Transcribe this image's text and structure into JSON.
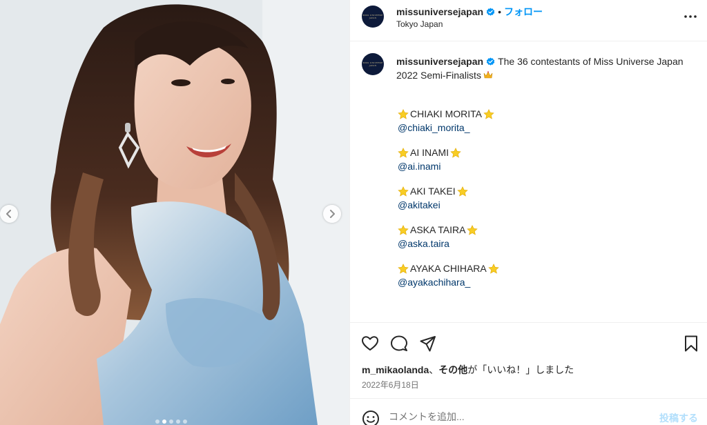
{
  "media": {
    "prev_icon": "chevron-left-icon",
    "next_icon": "chevron-right-icon",
    "carousel_count": 5,
    "carousel_active": 2
  },
  "header": {
    "username": "missuniversejapan",
    "separator": "•",
    "follow_label": "フォロー",
    "location": "Tokyo Japan",
    "more_icon": "more-options-icon"
  },
  "caption": {
    "username": "missuniversejapan",
    "text": "The 36 contestants of Miss Universe Japan 2022 Semi-Finalists"
  },
  "contestants": [
    {
      "name": "CHIAKI MORITA",
      "handle": "@chiaki_morita_"
    },
    {
      "name": "AI INAMI",
      "handle": "@ai.inami"
    },
    {
      "name": "AKI TAKEI",
      "handle": "@akitakei"
    },
    {
      "name": "ASKA TAIRA",
      "handle": "@aska.taira"
    },
    {
      "name": "AYAKA CHIHARA",
      "handle": "@ayakachihara_"
    }
  ],
  "actions": {
    "like_icon": "heart-icon",
    "comment_icon": "comment-icon",
    "share_icon": "share-icon",
    "save_icon": "bookmark-icon"
  },
  "likes": {
    "user": "m_mikaolanda",
    "connector": "、",
    "others": "その他",
    "suffix": "が「いいね！」しました"
  },
  "date": "2022年6月18日",
  "composer": {
    "placeholder": "コメントを追加...",
    "post_label": "投稿する",
    "emoji_icon": "emoji-icon"
  },
  "colors": {
    "accent": "#0095f6",
    "link": "#00376b",
    "star": "#f8cd25"
  }
}
